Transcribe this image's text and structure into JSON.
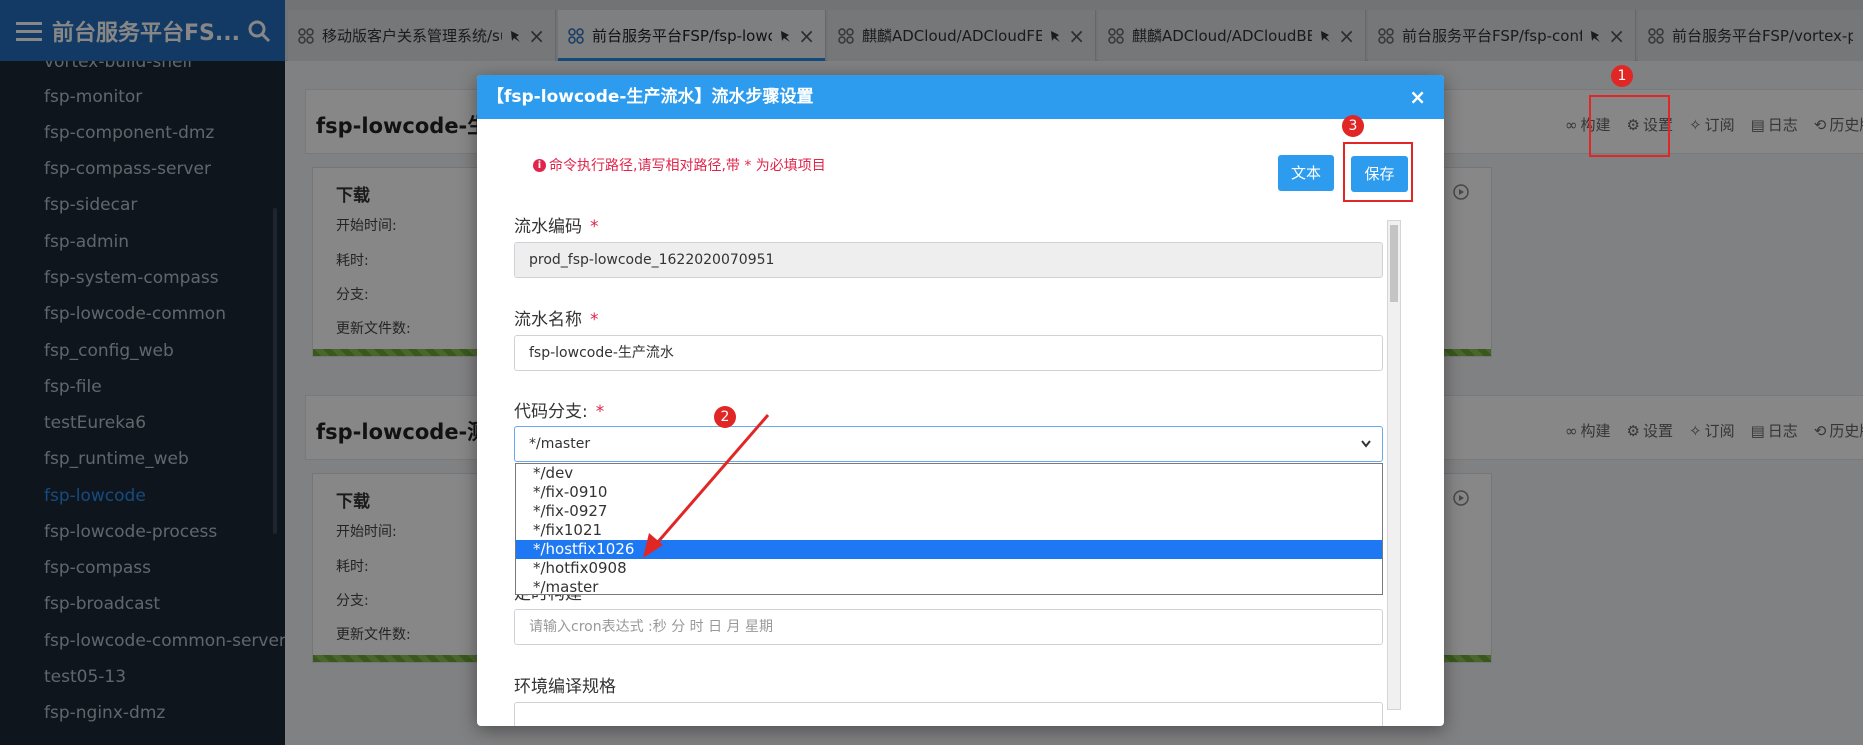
{
  "brand": {
    "title": "前台服务平台FS..."
  },
  "tabs": [
    {
      "label": "移动版客户关系管理系统/su"
    },
    {
      "label": "前台服务平台FSP/fsp-lowco"
    },
    {
      "label": "麒麟ADCloud/ADCloudFE纟"
    },
    {
      "label": "麒麟ADCloud/ADCloudBE纟"
    },
    {
      "label": "前台服务平台FSP/fsp-confi"
    },
    {
      "label": "前台服务平台FSP/vortex-p("
    }
  ],
  "sidebar": {
    "items": [
      {
        "label": "vortex-build-shell"
      },
      {
        "label": "fsp-monitor"
      },
      {
        "label": "fsp-component-dmz"
      },
      {
        "label": "fsp-compass-server"
      },
      {
        "label": "fsp-sidecar"
      },
      {
        "label": "fsp-admin"
      },
      {
        "label": "fsp-system-compass"
      },
      {
        "label": "fsp-lowcode-common"
      },
      {
        "label": "fsp_config_web"
      },
      {
        "label": "fsp-file"
      },
      {
        "label": "testEureka6"
      },
      {
        "label": "fsp_runtime_web"
      },
      {
        "label": "fsp-lowcode"
      },
      {
        "label": "fsp-lowcode-process"
      },
      {
        "label": "fsp-compass"
      },
      {
        "label": "fsp-broadcast"
      },
      {
        "label": "fsp-lowcode-common-server"
      },
      {
        "label": "test05-13"
      },
      {
        "label": "fsp-nginx-dmz"
      }
    ]
  },
  "actions": {
    "build": "构建",
    "settings": "设置",
    "subscribe": "订阅",
    "log": "日志",
    "history": "历史版"
  },
  "projects": [
    {
      "title": "fsp-lowcode-生",
      "stage": {
        "name": "下载",
        "start_label": "开始时间:",
        "duration_label": "耗时:",
        "branch_label": "分支:",
        "files_label": "更新文件数:"
      }
    },
    {
      "title": "fsp-lowcode-测",
      "stage": {
        "name": "下载",
        "start_label": "开始时间:",
        "duration_label": "耗时:",
        "branch_label": "分支:",
        "files_label": "更新文件数:"
      }
    }
  ],
  "modal": {
    "title": "【fsp-lowcode-生产流水】流水步骤设置",
    "close": "×",
    "notice": "命令执行路径,请写相对路径,带 * 为必填项目",
    "notice_icon": "i",
    "text_button": "文本",
    "save_button": "保存",
    "required_mark": "*",
    "pipeline_code": {
      "label": "流水编码",
      "value": "prod_fsp-lowcode_1622020070951"
    },
    "pipeline_name": {
      "label": "流水名称",
      "value": "fsp-lowcode-生产流水"
    },
    "branch": {
      "label": "代码分支:",
      "value": "*/master",
      "options": [
        "*/dev",
        "*/fix-0910",
        "*/fix-0927",
        "*/fix1021",
        "*/hostfix1026",
        "*/hotfix0908",
        "*/master"
      ],
      "highlighted": "*/hostfix1026"
    },
    "cron": {
      "label": "定时构建",
      "placeholder": "请输入cron表达式 :秒 分 时 日 月 星期"
    },
    "env": {
      "label": "环境编译规格"
    }
  },
  "annotations": {
    "badge1": "1",
    "badge2": "2",
    "badge3": "3"
  },
  "colors": {
    "brand": "#236fbd",
    "modal_header": "#2d9cef",
    "callout": "#e12626",
    "selected_option": "#1e77f3",
    "required": "#e1244a"
  }
}
